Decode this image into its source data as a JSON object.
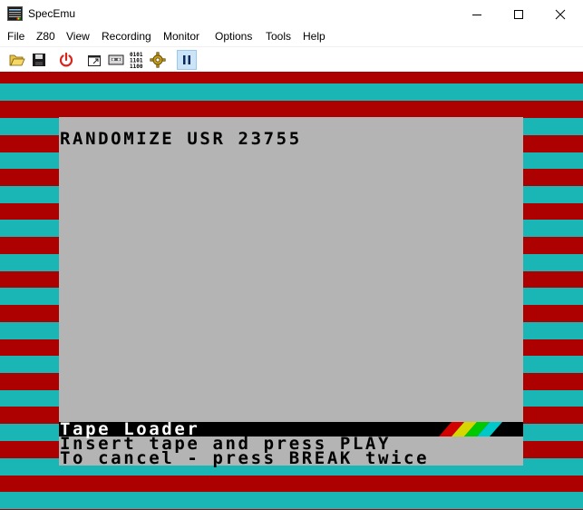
{
  "window": {
    "title": "SpecEmu",
    "controls": {
      "minimize": "minimize",
      "maximize": "maximize",
      "close": "close"
    }
  },
  "menu": [
    "File",
    "Z80",
    "View",
    "Recording",
    "Monitor",
    "Options",
    "Tools",
    "Help"
  ],
  "toolbar": {
    "buttons": [
      "open-folder",
      "save",
      "power",
      "resize-window",
      "tape",
      "binary",
      "settings-gear",
      "pause"
    ],
    "binary_icon_text": [
      "0101",
      "1101",
      "1100"
    ],
    "active": "pause"
  },
  "screen": {
    "command": "RANDOMIZE USR 23755",
    "loader_title": "Tape Loader",
    "line1": "Insert tape and press PLAY",
    "line2": "To cancel - press BREAK twice",
    "border_colors": [
      "#ad0000",
      "#1ab5b5"
    ],
    "paper_color": "#b4b4b4",
    "rainbow_colors": [
      "#d30000",
      "#d6d600",
      "#00c900",
      "#00c8c8"
    ]
  }
}
